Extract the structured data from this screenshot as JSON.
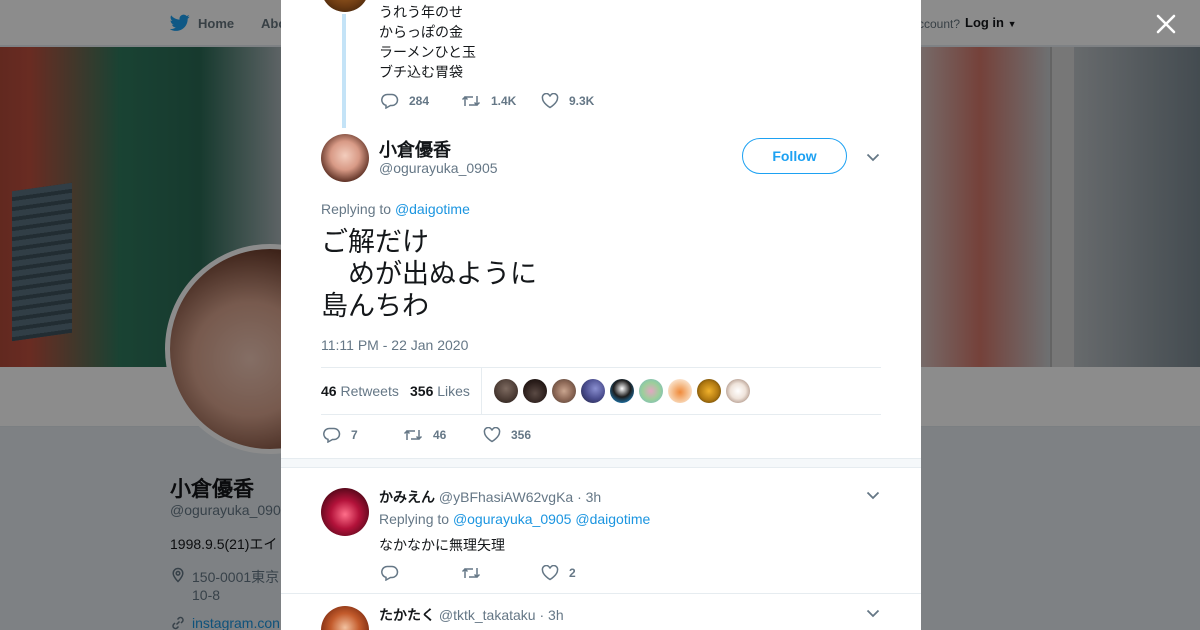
{
  "topnav": {
    "home_label": "Home",
    "about_label": "Abo",
    "account_text": "ccount?",
    "login_label": "Log in"
  },
  "background_profile": {
    "name": "小倉優香",
    "handle": "@ogurayuka_090",
    "bio": "1998.9.5(21)エイ",
    "location_line1": "150-0001東京",
    "location_line2": "10-8",
    "link": "instagram.con"
  },
  "previous_tweet": {
    "lines": [
      "うれう年のせ",
      "からっぽの金",
      "ラーメンひと玉",
      "ブチ込む胃袋"
    ],
    "reply_count": "284",
    "retweet_count": "1.4K",
    "like_count": "9.3K"
  },
  "main_tweet": {
    "author_name": "小倉優香",
    "author_handle": "@ogurayuka_0905",
    "follow_label": "Follow",
    "replying_prefix": "Replying to",
    "replying_to": "@daigotime",
    "text": "ご解だけ\n　めが出ぬように\n島んちわ",
    "timestamp": "11:11 PM - 22 Jan 2020",
    "retweets_count": "46",
    "retweets_label": "Retweets",
    "likes_count": "356",
    "likes_label": "Likes",
    "reply_count": "7",
    "retweet_count": "46",
    "like_count": "356"
  },
  "replies": [
    {
      "name": "かみえん",
      "handle": "@yBFhasiAW62vgKa",
      "time": "· 3h",
      "replying_prefix": "Replying to",
      "mention1": "@ogurayuka_0905",
      "mention2": "@daigotime",
      "text": "なかなかに無理矢理",
      "reply_count": "",
      "retweet_count": "",
      "like_count": "2"
    },
    {
      "name": "たかたく",
      "handle": "@tktk_takataku",
      "time": "· 3h"
    }
  ],
  "colors": {
    "accent": "#1da1f2",
    "link": "#1b95e0",
    "muted": "#657786",
    "thread_line": "#c4e3f7"
  }
}
